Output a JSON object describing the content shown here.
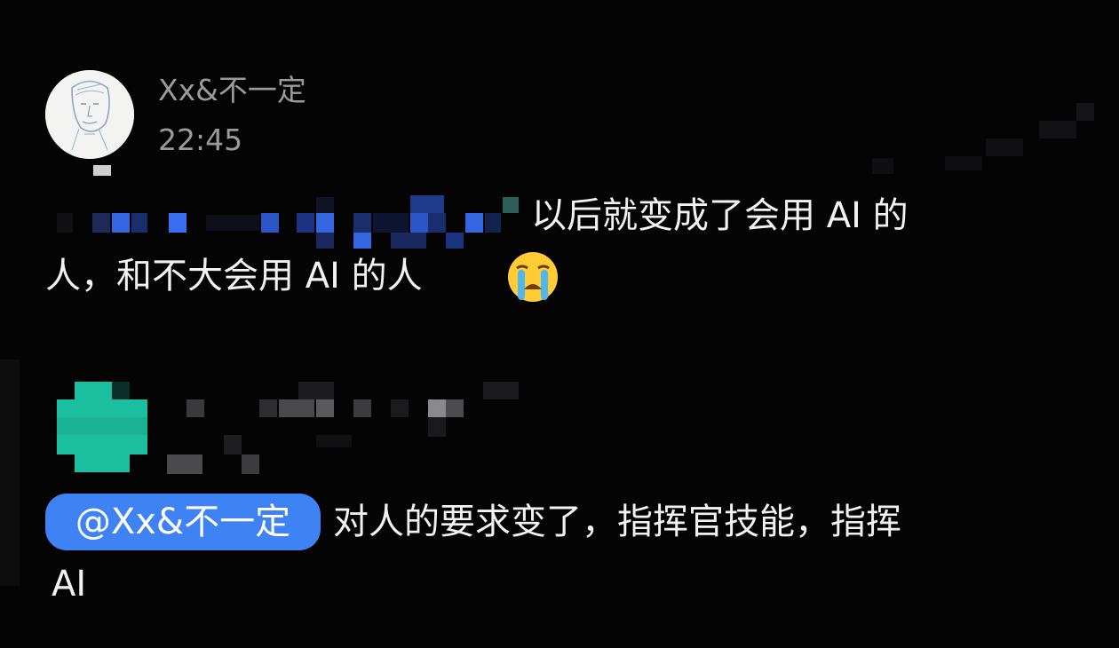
{
  "message1": {
    "username": "Xx&不一定",
    "time": "22:45",
    "line1_visible_text": "以后就变成了会用 AI 的",
    "line2_text": "人，和不大会用 AI 的人",
    "emoji": "loudly-crying-face-icon",
    "avatar_icon": "sketch-portrait-avatar"
  },
  "message2": {
    "mention": "@Xx&不一定",
    "line1_text": "对人的要求变了，指挥官技能，指挥",
    "line2_text": "AI",
    "avatar_icon": "pixelated-teal-avatar"
  },
  "colors": {
    "background": "#040405",
    "meta_text": "#9a9a9a",
    "mention_bg": "#3f82f4",
    "teal_avatar": "#1bbfa0",
    "pixel_blue": "#3366e0"
  }
}
